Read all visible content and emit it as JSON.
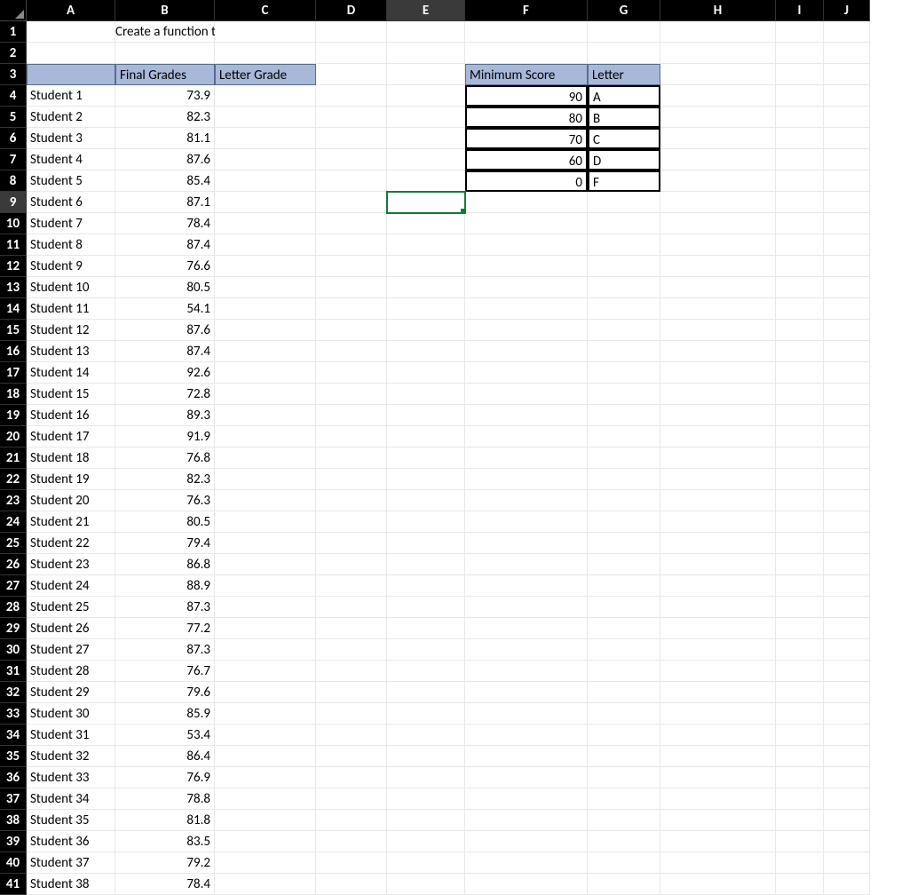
{
  "columns": [
    "A",
    "B",
    "C",
    "D",
    "E",
    "F",
    "G",
    "H",
    "I",
    "J"
  ],
  "selected_col": "E",
  "selected_row": 9,
  "instruction": "Create a function that determines a student's letter grade based on their final grade.",
  "headers": {
    "final_grades": "Final Grades",
    "letter_grade": "Letter Grade",
    "min_score": "Minimum Score",
    "letter": "Letter"
  },
  "grade_table": [
    {
      "min": 90,
      "letter": "A"
    },
    {
      "min": 80,
      "letter": "B"
    },
    {
      "min": 70,
      "letter": "C"
    },
    {
      "min": 60,
      "letter": "D"
    },
    {
      "min": 0,
      "letter": "F"
    }
  ],
  "students": [
    {
      "name": "Student 1",
      "grade": 73.9
    },
    {
      "name": "Student 2",
      "grade": 82.3
    },
    {
      "name": "Student 3",
      "grade": 81.1
    },
    {
      "name": "Student 4",
      "grade": 87.6
    },
    {
      "name": "Student 5",
      "grade": 85.4
    },
    {
      "name": "Student 6",
      "grade": 87.1
    },
    {
      "name": "Student 7",
      "grade": 78.4
    },
    {
      "name": "Student 8",
      "grade": 87.4
    },
    {
      "name": "Student 9",
      "grade": 76.6
    },
    {
      "name": "Student 10",
      "grade": 80.5
    },
    {
      "name": "Student 11",
      "grade": 54.1
    },
    {
      "name": "Student 12",
      "grade": 87.6
    },
    {
      "name": "Student 13",
      "grade": 87.4
    },
    {
      "name": "Student 14",
      "grade": 92.6
    },
    {
      "name": "Student 15",
      "grade": 72.8
    },
    {
      "name": "Student 16",
      "grade": 89.3
    },
    {
      "name": "Student 17",
      "grade": 91.9
    },
    {
      "name": "Student 18",
      "grade": 76.8
    },
    {
      "name": "Student 19",
      "grade": 82.3
    },
    {
      "name": "Student 20",
      "grade": 76.3
    },
    {
      "name": "Student 21",
      "grade": 80.5
    },
    {
      "name": "Student 22",
      "grade": 79.4
    },
    {
      "name": "Student 23",
      "grade": 86.8
    },
    {
      "name": "Student 24",
      "grade": 88.9
    },
    {
      "name": "Student 25",
      "grade": 87.3
    },
    {
      "name": "Student 26",
      "grade": 77.2
    },
    {
      "name": "Student 27",
      "grade": 87.3
    },
    {
      "name": "Student 28",
      "grade": 76.7
    },
    {
      "name": "Student 29",
      "grade": 79.6
    },
    {
      "name": "Student 30",
      "grade": 85.9
    },
    {
      "name": "Student 31",
      "grade": 53.4
    },
    {
      "name": "Student 32",
      "grade": 86.4
    },
    {
      "name": "Student 33",
      "grade": 76.9
    },
    {
      "name": "Student 34",
      "grade": 78.8
    },
    {
      "name": "Student 35",
      "grade": 81.8
    },
    {
      "name": "Student 36",
      "grade": 83.5
    },
    {
      "name": "Student 37",
      "grade": 79.2
    },
    {
      "name": "Student 38",
      "grade": 78.4
    }
  ],
  "visible_rows": 41
}
